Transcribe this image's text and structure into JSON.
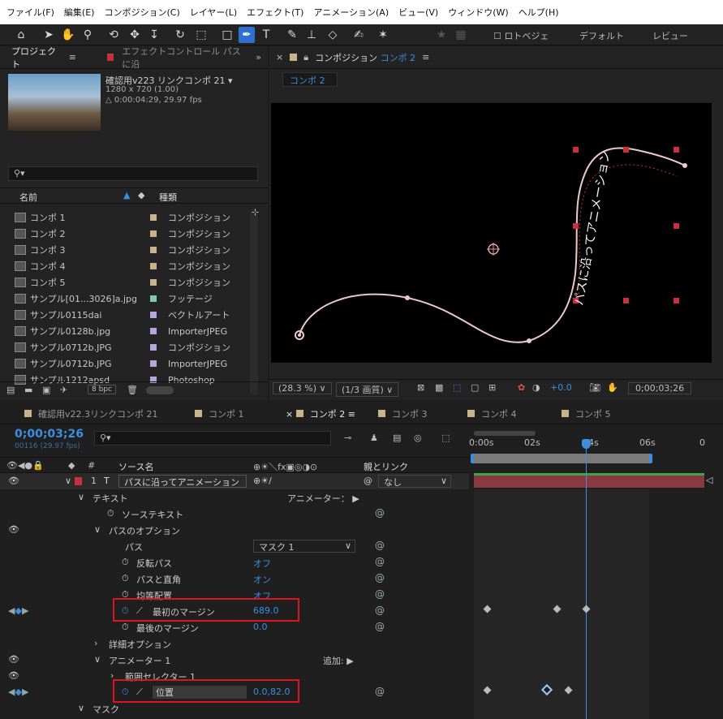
{
  "menu": [
    "ファイル(F)",
    "編集(E)",
    "コンポジション(C)",
    "レイヤー(L)",
    "エフェクト(T)",
    "アニメーション(A)",
    "ビュー(V)",
    "ウィンドウ(W)",
    "ヘルプ(H)"
  ],
  "toolbar": {
    "bezier_label": "ロトベジェ",
    "workspace1": "デフォルト",
    "workspace2": "レビュー"
  },
  "project": {
    "tab": "プロジェクト",
    "effects_tab": "エフェクトコントロール パスに沿",
    "comp_name": "確認用v223 リンクコンポ 21 ▾",
    "comp_size": "1280 x 720 (1.00)",
    "comp_duration": "△ 0:00:04:29, 29.97 fps",
    "col_name": "名前",
    "col_type": "種類",
    "bpc": "8 bpc",
    "items": [
      {
        "name": "コンポ 1",
        "type": "コンポジション",
        "color": "#c9b48a"
      },
      {
        "name": "コンポ 2",
        "type": "コンポジション",
        "color": "#c9b48a"
      },
      {
        "name": "コンポ 3",
        "type": "コンポジション",
        "color": "#c9b48a"
      },
      {
        "name": "コンポ 4",
        "type": "コンポジション",
        "color": "#c9b48a"
      },
      {
        "name": "コンポ 5",
        "type": "コンポジション",
        "color": "#c9b48a"
      },
      {
        "name": "サンプル[01...3026]a.jpg",
        "type": "フッテージ",
        "color": "#88c7b0"
      },
      {
        "name": "サンプル0115dai",
        "type": "ベクトルアート",
        "color": "#b7a6d8"
      },
      {
        "name": "サンプル0128b.jpg",
        "type": "ImporterJPEG",
        "color": "#b7a6d8"
      },
      {
        "name": "サンプル0712b.JPG",
        "type": "コンポジション",
        "color": "#b7a6d8"
      },
      {
        "name": "サンプル0712b.JPG",
        "type": "ImporterJPEG",
        "color": "#b7a6d8"
      },
      {
        "name": "サンプル1212apsd",
        "type": "Photoshop",
        "color": "#b7a6d8"
      }
    ]
  },
  "composition": {
    "tab_prefix": "コンポジション",
    "tab_name": "コンポ 2",
    "subtab": "コンポ 2",
    "path_text": "パスに沿ってアニメーション",
    "zoom": "(28.3 %)",
    "quality": "(1/3 画質)",
    "exposure": "+0.0",
    "timecode": "0;00;03;26"
  },
  "timeline": {
    "tabs": [
      "確認用v22.3リンクコンポ 21",
      "コンポ 1",
      "コンポ 2",
      "コンポ 3",
      "コンポ 4",
      "コンポ 5"
    ],
    "timecode": "0;00;03;26",
    "frames": "00116 (29.97 fps)",
    "col_source": "ソース名",
    "col_parent": "親とリンク",
    "ruler": [
      "0:00s",
      "02s",
      "04s",
      "06s",
      "0"
    ],
    "layer_num": "1",
    "layer_name": "パスに沿ってアニメーション",
    "parent_none": "なし",
    "rows": {
      "text": "テキスト",
      "animator_label": "アニメーター：",
      "source_text": "ソーステキスト",
      "path_options": "パスのオプション",
      "path": "パス",
      "path_value": "マスク 1",
      "reverse": "反転パス",
      "reverse_value": "オフ",
      "perpendicular": "パスと直角",
      "perpendicular_value": "オン",
      "force_align": "均等配置",
      "force_align_value": "オフ",
      "first_margin": "最初のマージン",
      "first_margin_value": "689.0",
      "last_margin": "最後のマージン",
      "last_margin_value": "0.0",
      "more_options": "詳細オプション",
      "animator1": "アニメーター 1",
      "add_label": "追加:",
      "range_selector": "範囲セレクター 1",
      "position": "位置",
      "position_value": "0.0,82.0",
      "mask": "マスク"
    }
  }
}
